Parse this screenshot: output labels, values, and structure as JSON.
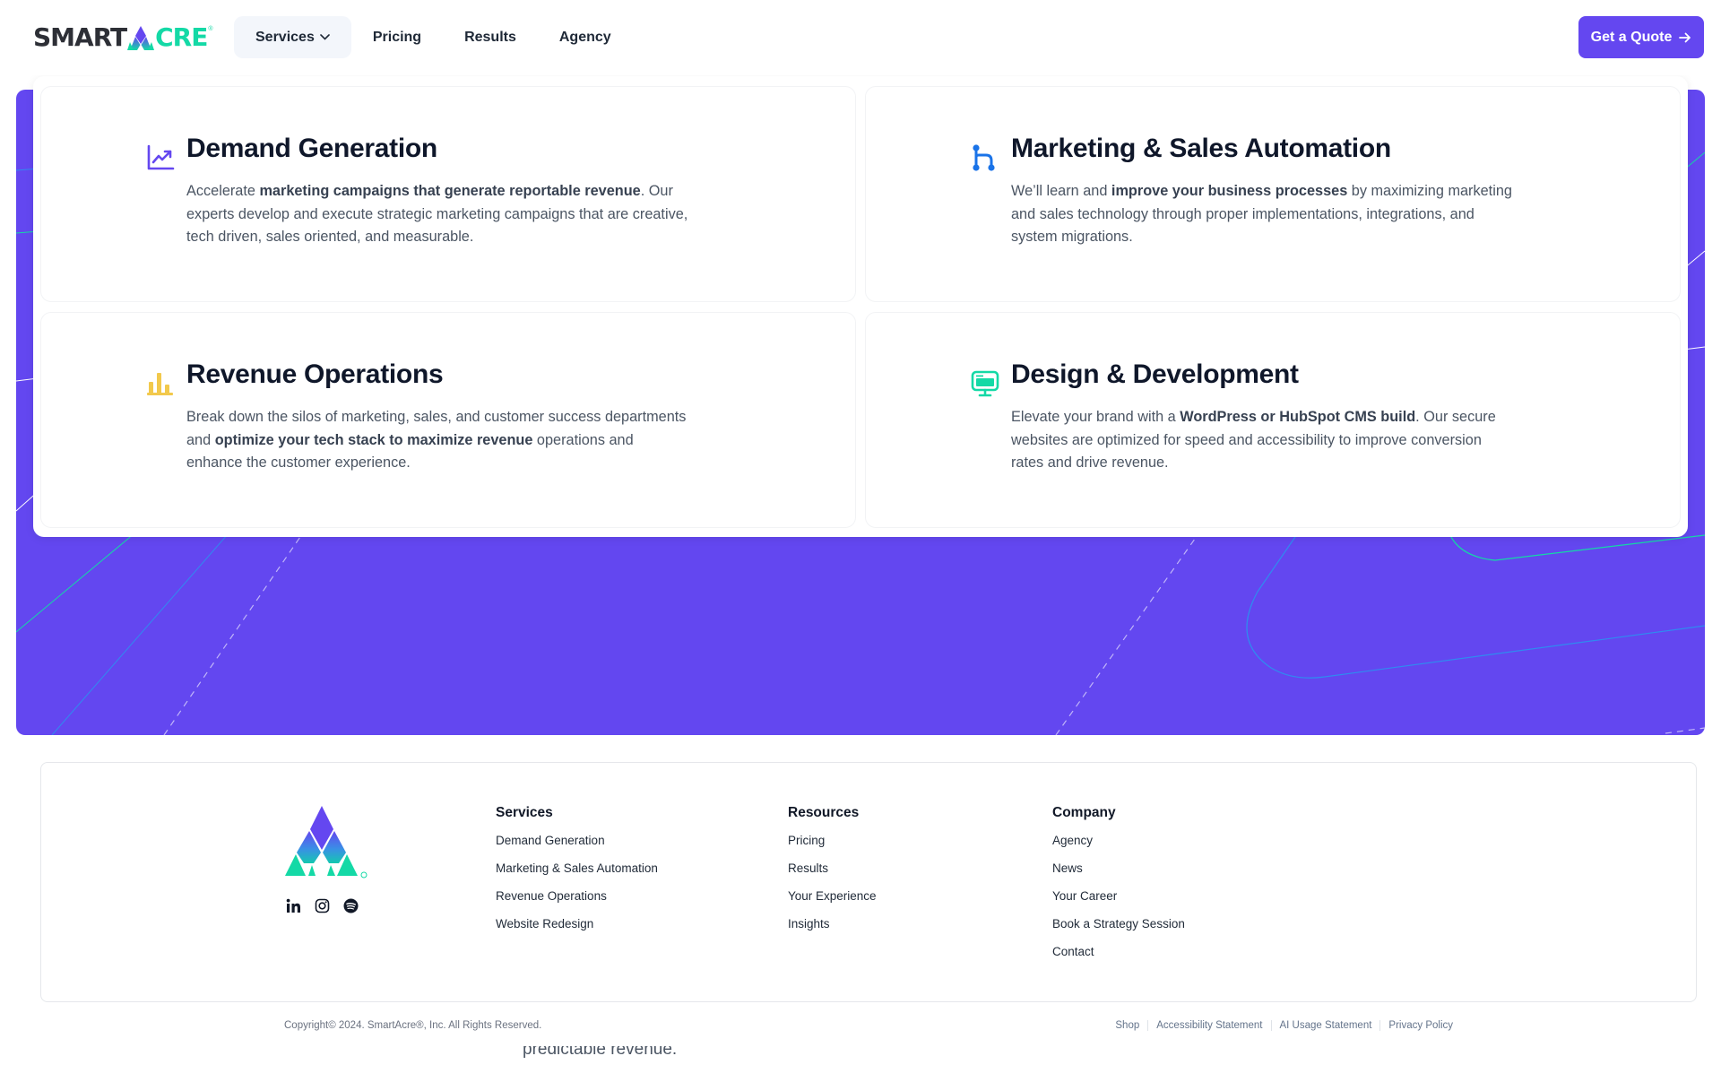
{
  "header": {
    "logo": {
      "part1": "SMART",
      "part2": "CRE",
      "registered": "®",
      "alt": "SmartAcre"
    },
    "nav": [
      {
        "label": "Services",
        "active": true,
        "has_dropdown": true
      },
      {
        "label": "Pricing",
        "active": false
      },
      {
        "label": "Results",
        "active": false
      },
      {
        "label": "Agency",
        "active": false
      }
    ],
    "cta_label": "Get a Quote",
    "cta_icon": "arrow-right-icon"
  },
  "services_menu": [
    {
      "title": "Demand Generation",
      "icon": "trending-chart-icon",
      "icon_color": "#6447f0",
      "desc_pre": "Accelerate ",
      "desc_bold": "marketing campaigns that generate reportable revenue",
      "desc_post": ". Our experts develop and execute strategic marketing campaigns that are creative, tech driven, sales oriented, and measurable."
    },
    {
      "title": "Marketing & Sales Automation",
      "icon": "workflow-icon",
      "icon_color": "#1a73e8",
      "desc_pre": "We’ll learn and ",
      "desc_bold": "improve your business processes",
      "desc_post": " by maximizing marketing and sales technology through proper implementations, integrations, and system migrations."
    },
    {
      "title": "Revenue Operations",
      "icon": "bar-chart-icon",
      "icon_color": "#f2c94c",
      "desc_pre": "Break down the silos of marketing, sales, and customer success departments and ",
      "desc_bold": "optimize your tech stack to maximize revenue",
      "desc_post": " operations and enhance the customer experience."
    },
    {
      "title": "Design & Development",
      "icon": "monitor-icon",
      "icon_color": "#14d9a6",
      "desc_pre": "Elevate your brand with a ",
      "desc_bold": "WordPress or HubSpot CMS build",
      "desc_post": ". Our secure websites are optimized for speed and accessibility to improve conversion rates and drive revenue."
    }
  ],
  "footer": {
    "socials": [
      {
        "name": "LinkedIn",
        "icon": "linkedin-icon"
      },
      {
        "name": "Instagram",
        "icon": "instagram-icon"
      },
      {
        "name": "Spotify",
        "icon": "spotify-icon"
      }
    ],
    "columns": [
      {
        "heading": "Services",
        "links": [
          "Demand Generation",
          "Marketing & Sales Automation",
          "Revenue Operations",
          "Website Redesign"
        ]
      },
      {
        "heading": "Resources",
        "links": [
          "Pricing",
          "Results",
          "Your Experience",
          "Insights"
        ]
      },
      {
        "heading": "Company",
        "links": [
          "Agency",
          "News",
          "Your Career",
          "Book a Strategy Session",
          "Contact"
        ]
      }
    ],
    "copyright": "Copyright© 2024. SmartAcre®, Inc. All Rights Reserved.",
    "legal_links": [
      "Shop",
      "Accessibility Statement",
      "AI Usage Statement",
      "Privacy Policy"
    ]
  },
  "background_text": "predictable revenue.",
  "colors": {
    "brand_purple": "#6447f0",
    "brand_teal": "#14d9a6",
    "dark": "#2d2f36"
  }
}
